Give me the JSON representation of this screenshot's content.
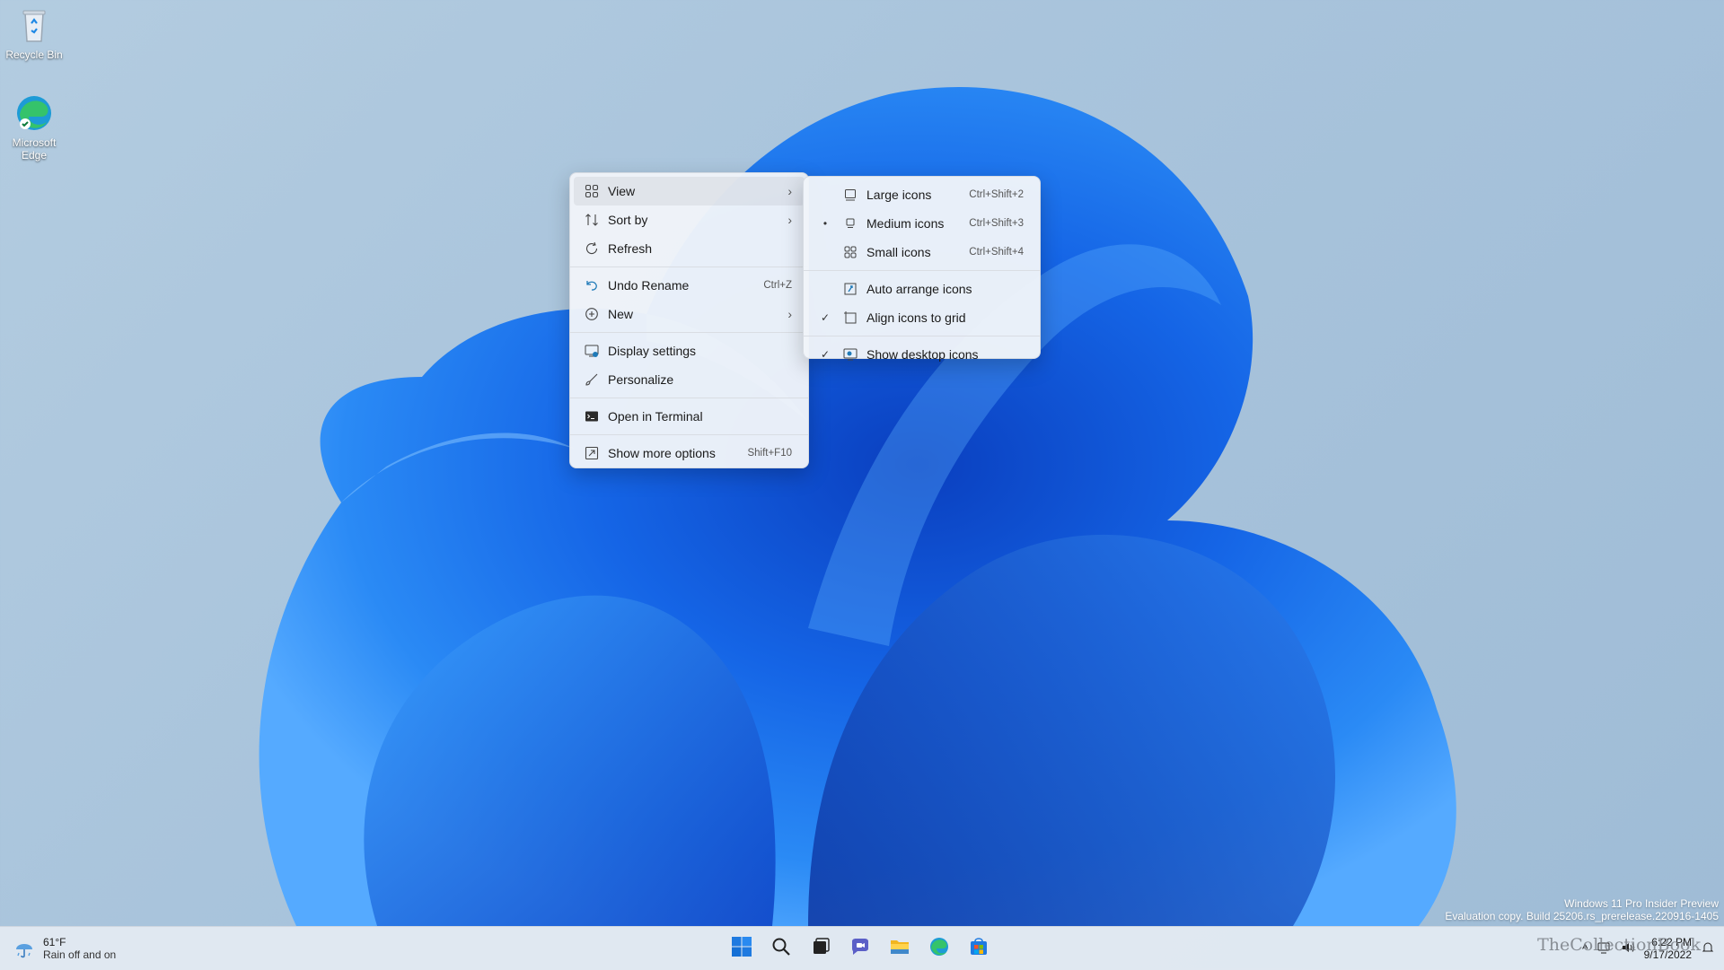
{
  "desktop": {
    "icons": [
      {
        "label": "Recycle Bin",
        "icon": "recycle-bin-icon"
      },
      {
        "label": "Microsoft Edge",
        "icon": "edge-icon"
      }
    ]
  },
  "context_menu": {
    "items": [
      {
        "label": "View",
        "icon": "grid-icon",
        "submenu": true
      },
      {
        "label": "Sort by",
        "icon": "sort-icon",
        "submenu": true
      },
      {
        "label": "Refresh",
        "icon": "refresh-icon"
      },
      {
        "label": "Undo Rename",
        "icon": "undo-icon",
        "shortcut": "Ctrl+Z"
      },
      {
        "label": "New",
        "icon": "plus-circle-icon",
        "submenu": true
      },
      {
        "label": "Display settings",
        "icon": "display-icon"
      },
      {
        "label": "Personalize",
        "icon": "brush-icon"
      },
      {
        "label": "Open in Terminal",
        "icon": "terminal-icon"
      },
      {
        "label": "Show more options",
        "icon": "more-options-icon",
        "shortcut": "Shift+F10"
      }
    ]
  },
  "view_submenu": {
    "items": [
      {
        "label": "Large icons",
        "shortcut": "Ctrl+Shift+2",
        "mark": ""
      },
      {
        "label": "Medium icons",
        "shortcut": "Ctrl+Shift+3",
        "mark": "•"
      },
      {
        "label": "Small icons",
        "shortcut": "Ctrl+Shift+4",
        "mark": ""
      },
      {
        "label": "Auto arrange icons",
        "mark": ""
      },
      {
        "label": "Align icons to grid",
        "mark": "✓"
      },
      {
        "label": "Show desktop icons",
        "mark": "✓"
      }
    ]
  },
  "watermark": {
    "line1": "Windows 11 Pro Insider Preview",
    "line2": "Evaluation copy. Build 25206.rs_prerelease.220916-1405"
  },
  "taskbar": {
    "weather_temp": "61°F",
    "weather_desc": "Rain off and on",
    "apps": [
      "start-icon",
      "search-icon",
      "task-view-icon",
      "chat-icon",
      "file-explorer-icon",
      "edge-icon",
      "store-icon"
    ],
    "time": "6:22 PM",
    "date": "9/17/2022",
    "brand": "TheCollectionBook"
  },
  "colors": {
    "accent": "#0067c0",
    "wallpaper_blue": "#1f6fe8"
  }
}
